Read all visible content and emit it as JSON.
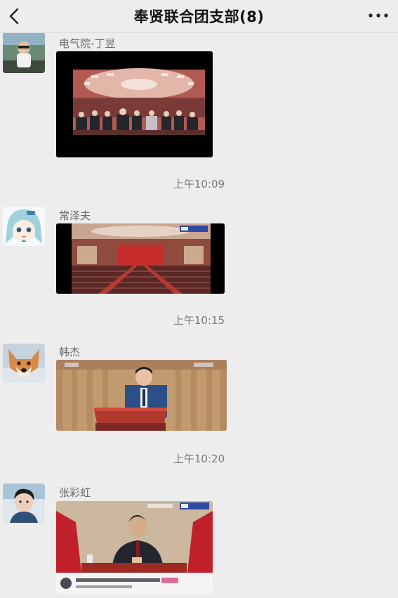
{
  "header": {
    "title": "奉贤联合团支部(8)"
  },
  "messages": [
    {
      "sender": "电气院-丁昱"
    },
    {
      "sender": "常泽夫",
      "time": "上午10:09"
    },
    {
      "sender": "韩杰",
      "time": "上午10:15"
    },
    {
      "sender": "张彩虹",
      "time": "上午10:20"
    }
  ],
  "colors": {
    "background": "#ededed",
    "thumb_frame": "#000000",
    "stage_red": "#b2252a"
  }
}
